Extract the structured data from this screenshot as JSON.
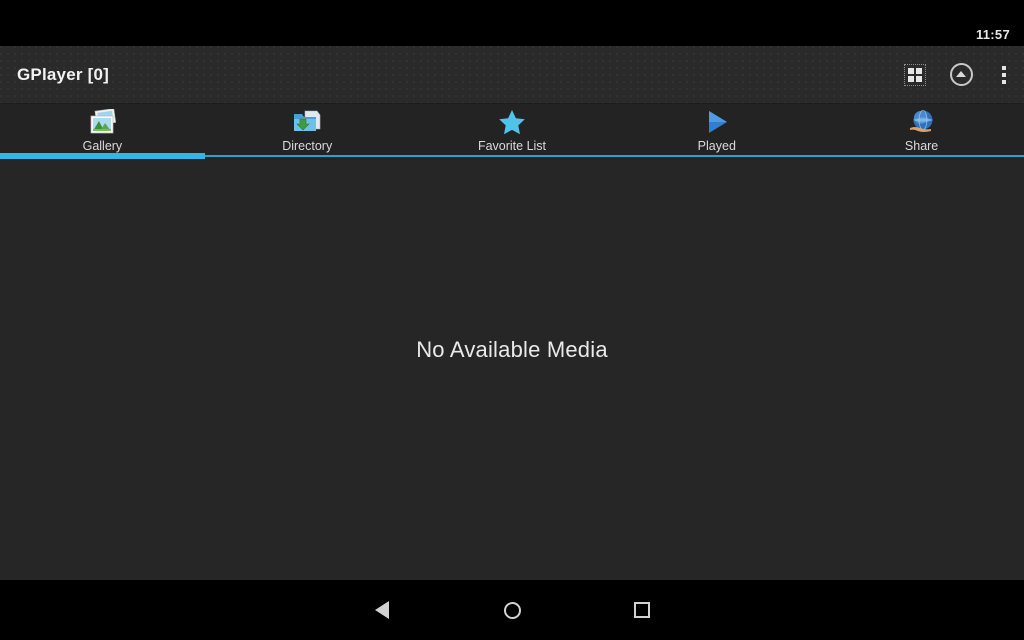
{
  "status_bar": {
    "time": "11:57"
  },
  "action_bar": {
    "title": "GPlayer [0]",
    "icons": [
      {
        "name": "grid-view-icon",
        "label": "Grid View"
      },
      {
        "name": "collapse-up-icon",
        "label": "Collapse"
      },
      {
        "name": "overflow-menu-icon",
        "label": "More options"
      }
    ]
  },
  "tabs": {
    "selected_index": 0,
    "indicator_color": "#33b5e5",
    "underline_color": "#2f9fd0",
    "items": [
      {
        "label": "Gallery",
        "icon": "photos-icon"
      },
      {
        "label": "Directory",
        "icon": "folder-download-icon"
      },
      {
        "label": "Favorite List",
        "icon": "star-icon"
      },
      {
        "label": "Played",
        "icon": "play-triangle-icon"
      },
      {
        "label": "Share",
        "icon": "globe-hand-icon"
      }
    ]
  },
  "content": {
    "empty_message": "No Available Media",
    "background_color": "#262626"
  },
  "nav_bar": {
    "buttons": [
      {
        "name": "back",
        "label": "Back"
      },
      {
        "name": "home",
        "label": "Home"
      },
      {
        "name": "recents",
        "label": "Recent apps"
      }
    ]
  }
}
